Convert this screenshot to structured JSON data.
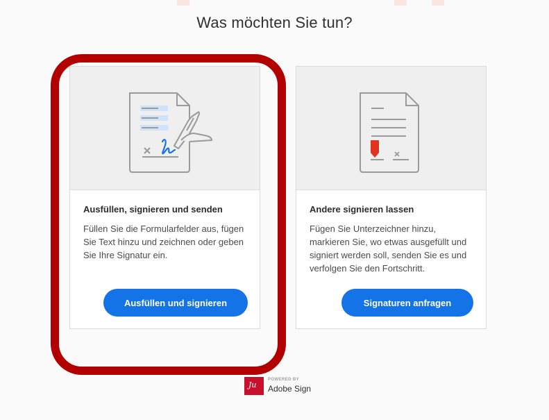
{
  "page": {
    "title": "Was möchten Sie tun?"
  },
  "cards": [
    {
      "title": "Ausfüllen, signieren und senden",
      "description": "Füllen Sie die Formularfelder aus, fügen Sie Text hinzu und zeichnen oder geben Sie Ihre Signatur ein.",
      "button_label": "Ausfüllen und signieren",
      "illustration": "fill-sign-document-icon"
    },
    {
      "title": "Andere signieren lassen",
      "description": "Fügen Sie Unterzeichner hinzu, markieren Sie, wo etwas ausgefüllt und signiert werden soll, senden Sie es und verfolgen Sie den Fortschritt.",
      "button_label": "Signaturen anfragen",
      "illustration": "request-signature-document-icon"
    }
  ],
  "footer": {
    "powered_by": "POWERED BY",
    "brand": "Adobe Sign",
    "logo": "adobe-sign-logo"
  },
  "colors": {
    "accent": "#1473e6",
    "highlight": "#b20000",
    "brand": "#c8102e"
  }
}
